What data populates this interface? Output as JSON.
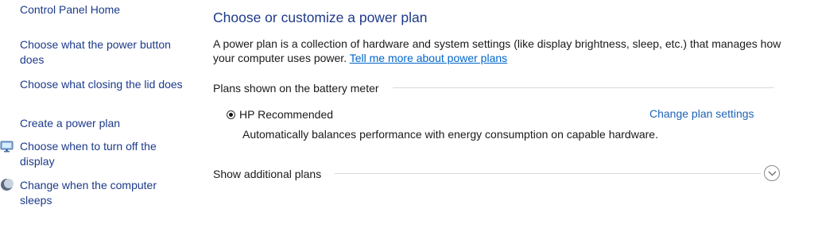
{
  "sidebar": {
    "home": "Control Panel Home",
    "items": [
      {
        "label": "Choose what the power button does"
      },
      {
        "label": "Choose what closing the lid does"
      },
      {
        "label": "Create a power plan"
      },
      {
        "label": "Choose when to turn off the display",
        "icon": "display-icon"
      },
      {
        "label": "Change when the computer sleeps",
        "icon": "moon-icon"
      }
    ]
  },
  "main": {
    "title": "Choose or customize a power plan",
    "description": "A power plan is a collection of hardware and system settings (like display brightness, sleep, etc.) that manages how your computer uses power. ",
    "description_link": "Tell me more about power plans",
    "battery_section_label": "Plans shown on the battery meter",
    "plan": {
      "name": "HP Recommended",
      "selected": true,
      "change_link": "Change plan settings",
      "description": "Automatically balances performance with energy consumption on capable hardware."
    },
    "additional_plans_label": "Show additional plans",
    "expand_icon": "chevron-down-icon"
  },
  "colors": {
    "link": "#1e63b8",
    "title": "#1e3a8a",
    "divider": "#d9d9d9"
  }
}
